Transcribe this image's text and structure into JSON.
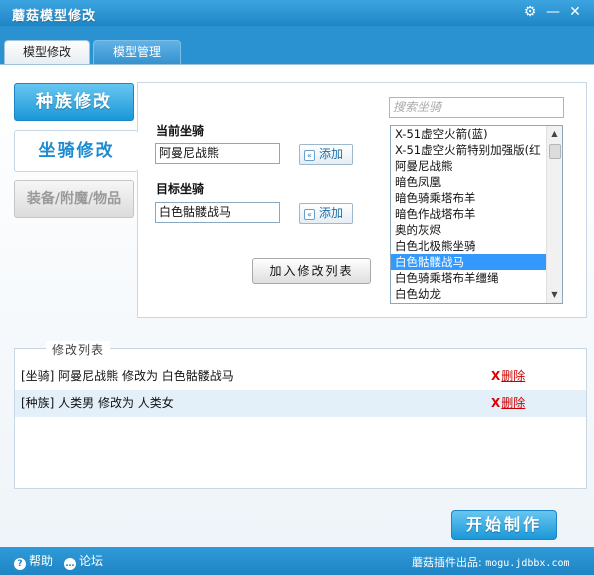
{
  "window": {
    "title": "蘑菇模型修改",
    "gear_icon": "⚙",
    "min_icon": "—",
    "close_icon": "✕"
  },
  "tabs": [
    {
      "label": "模型修改",
      "active": true
    },
    {
      "label": "模型管理",
      "active": false
    }
  ],
  "sidebar": {
    "race_label": "种族修改",
    "mount_label": "坐骑修改",
    "gear_label": "装备/附魔/物品"
  },
  "editor": {
    "current_label": "当前坐骑",
    "current_value": "阿曼尼战熊",
    "target_label": "目标坐骑",
    "target_value": "白色骷髅战马",
    "add_label": "添加",
    "add_arrow": "«",
    "add_to_list_label": "加入修改列表",
    "search_placeholder": "搜索坐骑"
  },
  "mount_list": {
    "items": [
      "X-51虚空火箭(蓝)",
      "X-51虚空火箭特别加强版(红",
      "阿曼尼战熊",
      "暗色凤凰",
      "暗色骑乘塔布羊",
      "暗色作战塔布羊",
      "奥的灰烬",
      "白色北极熊坐骑",
      "白色骷髅战马",
      "白色骑乘塔布羊缰绳",
      "白色幼龙"
    ],
    "selected_index": 8,
    "up_arrow": "▲",
    "down_arrow": "▼"
  },
  "mod_list": {
    "legend": "修改列表",
    "rows": [
      {
        "text": "[坐骑] 阿曼尼战熊 修改为 白色骷髅战马",
        "delete_label": "删除"
      },
      {
        "text": "[种族] 人类男 修改为 人类女",
        "delete_label": "删除"
      }
    ],
    "delete_x": "X"
  },
  "start_button": "开始制作",
  "footer": {
    "help_label": "帮助",
    "forum_label": "论坛",
    "help_icon": "?",
    "forum_icon": "…",
    "credit_prefix": "蘑菇插件出品:",
    "credit_url": "mogu.jdbbx.com"
  },
  "colors": {
    "accent": "#2a92d0",
    "button_blue": "#1b98d8",
    "selection": "#3399ff",
    "delete_red": "#cc0000"
  }
}
